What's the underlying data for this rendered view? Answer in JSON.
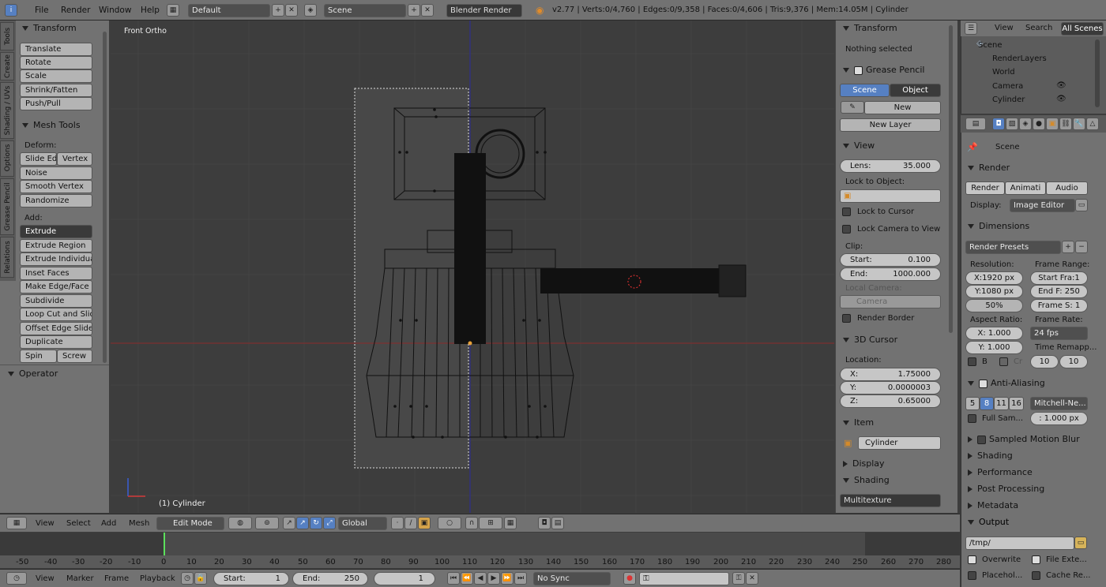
{
  "topbar": {
    "menus": [
      "File",
      "Render",
      "Window",
      "Help"
    ],
    "layout": "Default",
    "scene": "Scene",
    "engine": "Blender Render",
    "stats": "v2.77 | Verts:0/4,760 | Edges:0/9,358 | Faces:0/4,606 | Tris:9,376 | Mem:14.05M | Cylinder"
  },
  "left_tabs": [
    "Tools",
    "Create",
    "Shading / UVs",
    "Options",
    "Grease Pencil",
    "Relations"
  ],
  "tool_shelf": {
    "transform_title": "Transform",
    "transform": [
      "Translate",
      "Rotate",
      "Scale",
      "Shrink/Fatten",
      "Push/Pull"
    ],
    "mesh_tools_title": "Mesh Tools",
    "deform_label": "Deform:",
    "slide_edge": "Slide Ed",
    "vertex": "Vertex",
    "noise": "Noise",
    "smooth_vertex": "Smooth Vertex",
    "randomize": "Randomize",
    "add_label": "Add:",
    "extrude": "Extrude",
    "add_items": [
      "Extrude Region",
      "Extrude Individual",
      "Inset Faces",
      "Make Edge/Face",
      "Subdivide",
      "Loop Cut and Slide",
      "Offset Edge Slide",
      "Duplicate"
    ],
    "spin": "Spin",
    "screw": "Screw",
    "operator_title": "Operator"
  },
  "viewport": {
    "view_label": "Front Ortho",
    "object_label": "(1) Cylinder"
  },
  "properties_n": {
    "transform_title": "Transform",
    "nothing_selected": "Nothing selected",
    "grease_pencil_title": "Grease Pencil",
    "scene_btn": "Scene",
    "object_btn": "Object",
    "new_btn": "New",
    "new_layer_btn": "New Layer",
    "view_title": "View",
    "lens_label": "Lens:",
    "lens_value": "35.000",
    "lock_to_object": "Lock to Object:",
    "lock_to_cursor": "Lock to Cursor",
    "lock_camera": "Lock Camera to View",
    "clip_label": "Clip:",
    "start_label": "Start:",
    "start_value": "0.100",
    "end_label": "End:",
    "end_value": "1000.000",
    "local_camera": "Local Camera:",
    "camera_field": "Camera",
    "render_border": "Render Border",
    "cursor_title": "3D Cursor",
    "location_label": "Location:",
    "x_label": "X:",
    "x_value": "1.75000",
    "y_label": "Y:",
    "y_value": "0.0000003",
    "z_label": "Z:",
    "z_value": "0.65000",
    "item_title": "Item",
    "item_name": "Cylinder",
    "display_title": "Display",
    "shading_title": "Shading",
    "shading_value": "Multitexture"
  },
  "outliner": {
    "view": "View",
    "search": "Search",
    "all_scenes": "All Scenes",
    "items": [
      "Scene",
      "RenderLayers",
      "World",
      "Camera",
      "Cylinder"
    ]
  },
  "render_props": {
    "scene_label": "Scene",
    "render_title": "Render",
    "render_btn": "Render",
    "animation_btn": "Animati",
    "audio_btn": "Audio",
    "display_label": "Display:",
    "display_value": "Image Editor",
    "dimensions_title": "Dimensions",
    "render_presets": "Render Presets",
    "resolution_label": "Resolution:",
    "frame_range_label": "Frame Range:",
    "res_x": "X:1920 px",
    "res_y": "Y:1080 px",
    "res_pct": "50%",
    "start_frame": "Start Fra:1",
    "end_frame": "End F: 250",
    "frame_step": "Frame S: 1",
    "aspect_label": "Aspect Ratio:",
    "frame_rate_label": "Frame Rate:",
    "aspect_x": "X:    1.000",
    "aspect_y": "Y:    1.000",
    "fps": "24 fps",
    "time_remap": "Time Remapp...",
    "b_label": "B",
    "cr_label": "Cr",
    "remap_old": "10",
    "remap_new": "10",
    "aa_title": "Anti-Aliasing",
    "aa_samples": [
      "5",
      "8",
      "11",
      "16"
    ],
    "aa_filter": "Mitchell-Ne...",
    "full_sample": "Full Sam...",
    "filter_size": ": 1.000 px",
    "motion_blur": "Sampled Motion Blur",
    "shading": "Shading",
    "performance": "Performance",
    "post_processing": "Post Processing",
    "metadata": "Metadata",
    "output_title": "Output",
    "output_path": "/tmp/",
    "overwrite": "Overwrite",
    "file_ext": "File Exte...",
    "placeholders": "Placehol...",
    "cache_result": "Cache Re..."
  },
  "view3d_header": {
    "menus": [
      "View",
      "Select",
      "Add",
      "Mesh"
    ],
    "mode": "Edit Mode",
    "orientation": "Global"
  },
  "timeline": {
    "ticks": [
      "-50",
      "-40",
      "-30",
      "-20",
      "-10",
      "0",
      "10",
      "20",
      "30",
      "40",
      "50",
      "60",
      "70",
      "80",
      "90",
      "100",
      "110",
      "120",
      "130",
      "140",
      "150",
      "160",
      "170",
      "180",
      "190",
      "200",
      "210",
      "220",
      "230",
      "240",
      "250",
      "260",
      "270",
      "280"
    ],
    "current_frame": 0
  },
  "timeline_header": {
    "menus": [
      "View",
      "Marker",
      "Frame",
      "Playback"
    ],
    "start_label": "Start:",
    "start_value": "1",
    "end_label": "End:",
    "end_value": "250",
    "current": "1",
    "sync": "No Sync"
  }
}
